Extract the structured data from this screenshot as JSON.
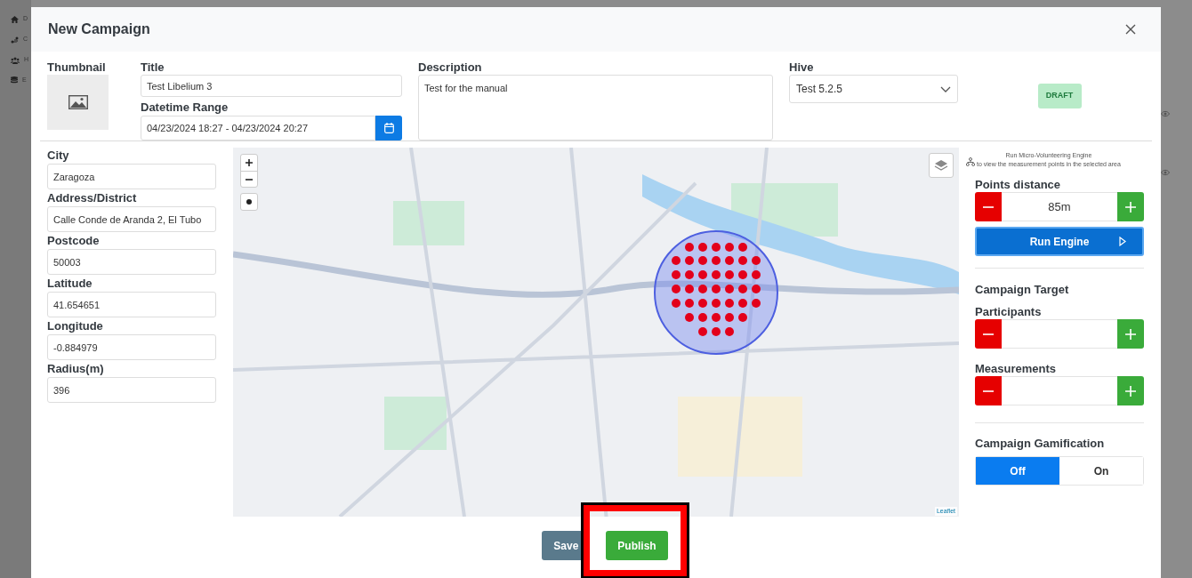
{
  "backdrop": {
    "sidebar_items": [
      {
        "label": "D"
      },
      {
        "label": "C"
      },
      {
        "label": "H"
      },
      {
        "label": "E"
      }
    ]
  },
  "modal": {
    "title": "New Campaign"
  },
  "thumbnail": {
    "label": "Thumbnail"
  },
  "title_field": {
    "label": "Title",
    "value": "Test Libelium 3"
  },
  "datetime_field": {
    "label": "Datetime Range",
    "value": "04/23/2024 18:27 - 04/23/2024 20:27"
  },
  "description_field": {
    "label": "Description",
    "value": "Test for the manual"
  },
  "hive_field": {
    "label": "Hive",
    "value": "Test 5.2.5"
  },
  "status_badge": "DRAFT",
  "location_fields": [
    {
      "label": "City",
      "value": "Zaragoza"
    },
    {
      "label": "Address/District",
      "value": "Calle Conde de Aranda 2, El Tubo"
    },
    {
      "label": "Postcode",
      "value": "50003"
    },
    {
      "label": "Latitude",
      "value": "41.654651"
    },
    {
      "label": "Longitude",
      "value": "-0.884979"
    },
    {
      "label": "Radius(m)",
      "value": "396"
    }
  ],
  "map": {
    "attribution": "Leaflet"
  },
  "engine": {
    "hint_title": "Run Micro-Volunteering Engine",
    "hint_text": "to view the measurement points in the selected area",
    "distance_label": "Points distance",
    "distance_value": "85m",
    "run_button": "Run Engine"
  },
  "target": {
    "heading": "Campaign Target",
    "counters": [
      {
        "label": "Participants"
      },
      {
        "label": "Measurements"
      }
    ]
  },
  "gamification": {
    "label": "Campaign Gamification",
    "options": [
      {
        "label": "Off",
        "selected": true
      },
      {
        "label": "On",
        "selected": false
      }
    ]
  },
  "buttons": [
    {
      "label": "Save",
      "kind": "secondary",
      "highlighted": false
    },
    {
      "label": "Publish",
      "kind": "primary",
      "highlighted": true
    }
  ]
}
